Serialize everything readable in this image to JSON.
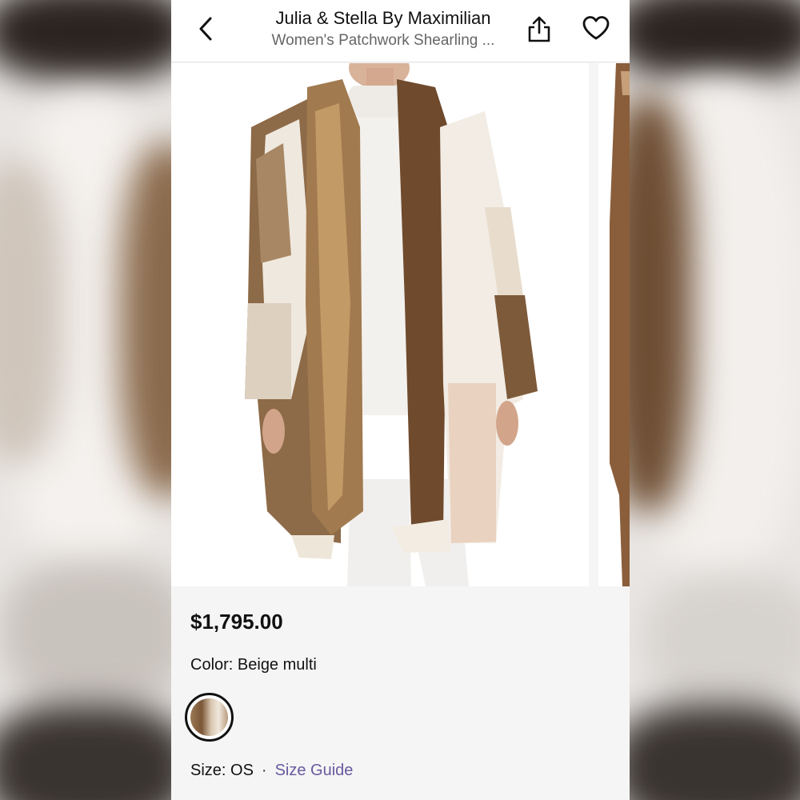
{
  "header": {
    "brand": "Julia & Stella By Maximilian",
    "subtitle": "Women's Patchwork Shearling ...",
    "back_icon": "chevron-left-icon",
    "share_icon": "share-icon",
    "favorite_icon": "heart-icon"
  },
  "product": {
    "price": "$1,795.00",
    "color_label": "Color: Beige multi",
    "size_label": "Size: OS",
    "size_separator": "·",
    "size_guide_label": "Size Guide"
  },
  "colors": {
    "accent_link": "#6a5a9e",
    "text_primary": "#111111",
    "text_secondary": "#666666"
  }
}
